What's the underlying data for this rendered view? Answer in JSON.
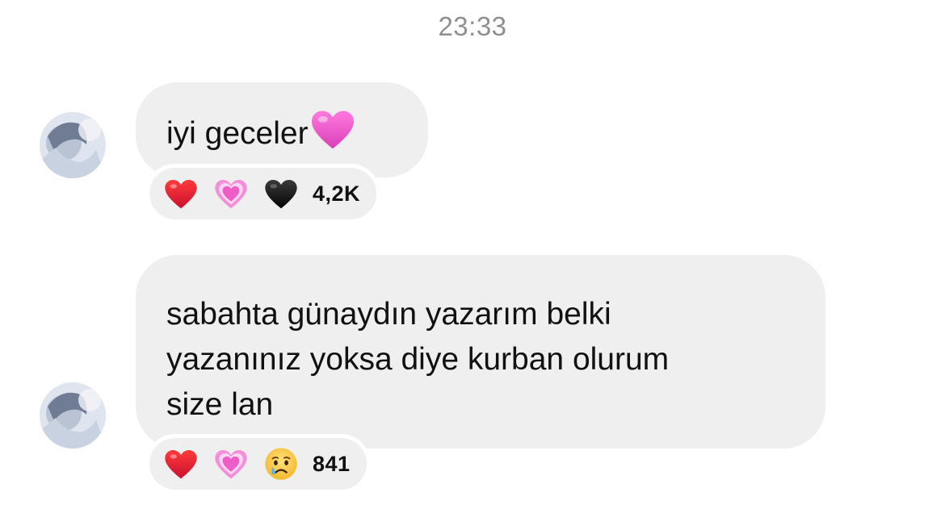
{
  "thread": {
    "timestamp": "23:33"
  },
  "messages": [
    {
      "text": "iyi geceler",
      "trailing_emoji": "pink-heart",
      "reactions": {
        "emojis": [
          "red-heart",
          "growing-heart",
          "black-heart"
        ],
        "count": "4,2K"
      }
    },
    {
      "lines": [
        "sabahta günaydın yazarım belki",
        "yazanınız yoksa diye kurban olurum",
        "size lan"
      ],
      "reactions": {
        "emojis": [
          "red-heart",
          "growing-heart",
          "crying-face"
        ],
        "count": "841"
      }
    }
  ],
  "colors": {
    "bubble": "#efefef",
    "timestamp": "#8e8e93",
    "text": "#111111"
  }
}
